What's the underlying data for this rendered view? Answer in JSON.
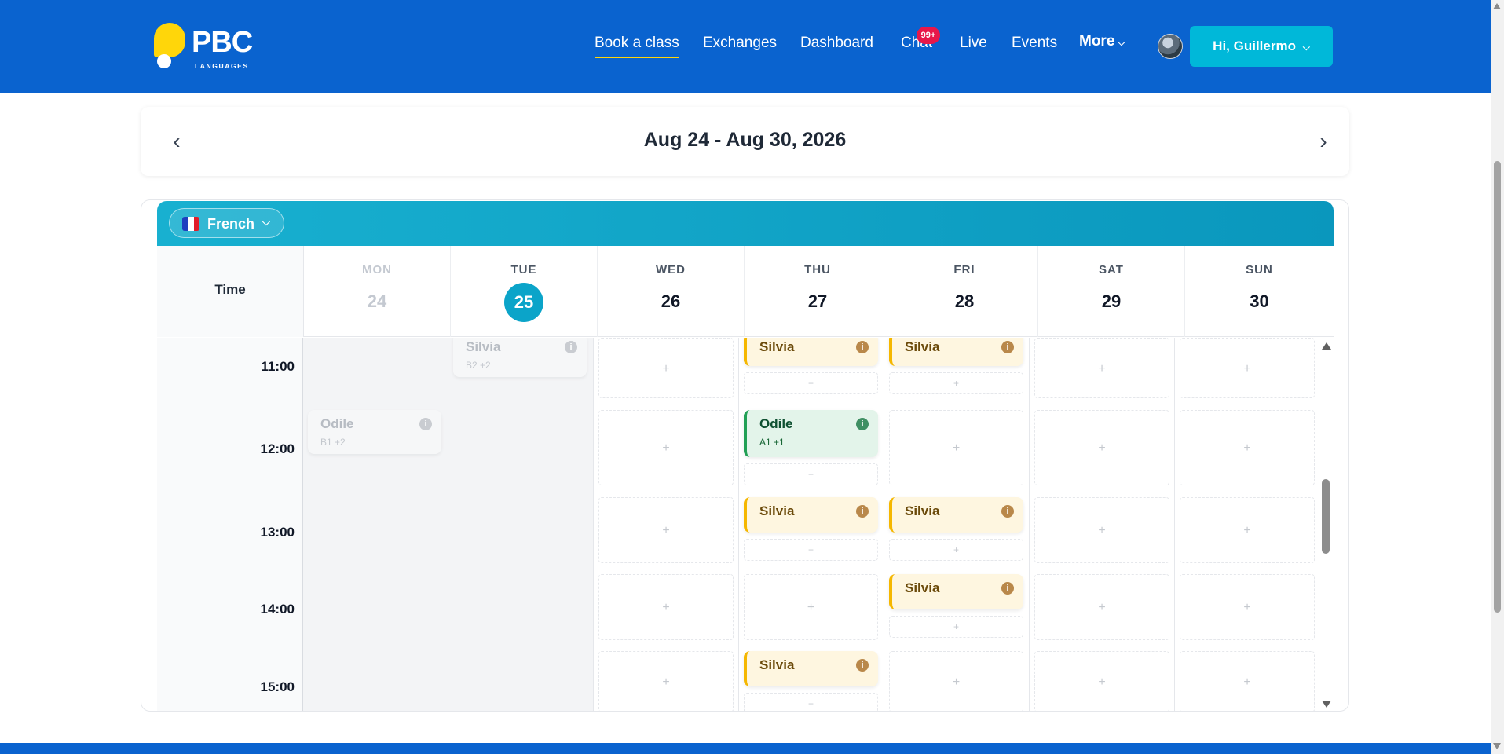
{
  "brand": {
    "name": "PBC",
    "tagline": "LANGUAGES",
    "color": "#0a63cf",
    "accent": "#ffd60a"
  },
  "nav": {
    "items": [
      {
        "label": "Book a class",
        "active": true
      },
      {
        "label": "Exchanges",
        "active": false
      },
      {
        "label": "Dashboard",
        "active": false
      },
      {
        "label": "Chat",
        "active": false
      },
      {
        "label": "Live",
        "active": false
      },
      {
        "label": "Events",
        "active": false
      },
      {
        "label": "More",
        "active": false
      }
    ],
    "chat_badge": "99+",
    "user_button": "Hi, Guillermo"
  },
  "week": {
    "range": "Aug 24 - Aug 30, 2026"
  },
  "language": {
    "label": "French",
    "flag_colors": [
      "#1f3fbf",
      "#ffffff",
      "#e11d2a"
    ]
  },
  "calendar": {
    "time_header": "Time",
    "days": [
      {
        "dow": "MON",
        "num": "24",
        "state": "past"
      },
      {
        "dow": "TUE",
        "num": "25",
        "state": "today"
      },
      {
        "dow": "WED",
        "num": "26",
        "state": "future"
      },
      {
        "dow": "THU",
        "num": "27",
        "state": "future"
      },
      {
        "dow": "FRI",
        "num": "28",
        "state": "future"
      },
      {
        "dow": "SAT",
        "num": "29",
        "state": "future"
      },
      {
        "dow": "SUN",
        "num": "30",
        "state": "future"
      }
    ],
    "hours": [
      "11:00",
      "12:00",
      "13:00",
      "14:00",
      "15:00"
    ],
    "slot_plus": "+",
    "info_glyph": "i",
    "events": [
      {
        "day": "TUE",
        "hour": "11:00",
        "name": "Silvia",
        "sub": "B2 +2",
        "style": "faded"
      },
      {
        "day": "MON",
        "hour": "12:00",
        "name": "Odile",
        "sub": "B1 +2",
        "style": "faded"
      },
      {
        "day": "THU",
        "hour": "11:00",
        "name": "Silvia",
        "sub": "",
        "style": "yellow"
      },
      {
        "day": "FRI",
        "hour": "11:00",
        "name": "Silvia",
        "sub": "",
        "style": "yellow"
      },
      {
        "day": "THU",
        "hour": "12:00",
        "name": "Odile",
        "sub": "A1 +1",
        "style": "green"
      },
      {
        "day": "THU",
        "hour": "13:00",
        "name": "Silvia",
        "sub": "",
        "style": "yellow"
      },
      {
        "day": "FRI",
        "hour": "13:00",
        "name": "Silvia",
        "sub": "",
        "style": "yellow"
      },
      {
        "day": "FRI",
        "hour": "14:00",
        "name": "Silvia",
        "sub": "",
        "style": "yellow"
      },
      {
        "day": "THU",
        "hour": "15:00",
        "name": "Silvia",
        "sub": "",
        "style": "yellow"
      }
    ]
  },
  "icons": {
    "prev_week": "chevron-left-icon",
    "next_week": "chevron-right-icon",
    "caret": "chevron-down-icon",
    "info": "info-icon",
    "add": "plus-icon"
  }
}
